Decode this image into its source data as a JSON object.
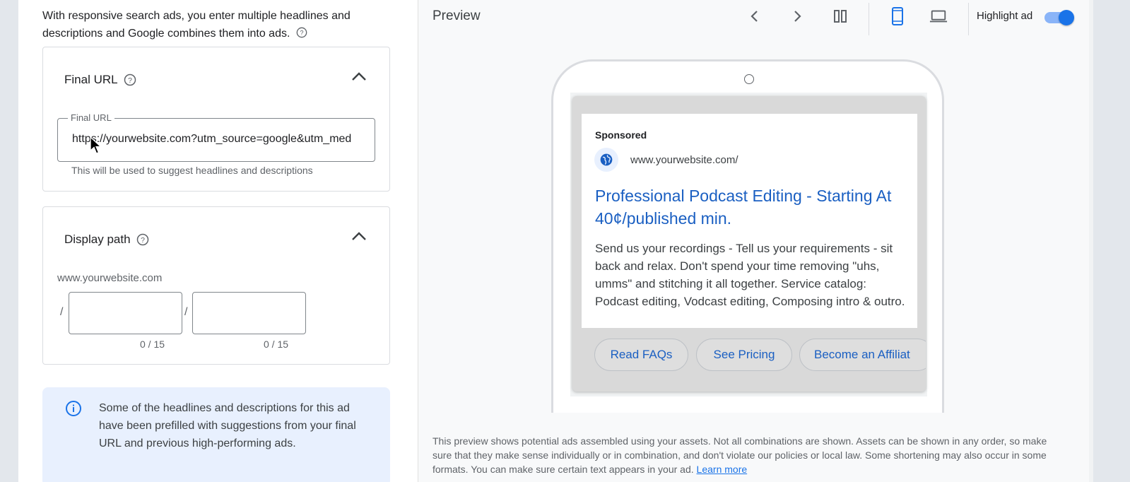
{
  "intro": {
    "text": "With responsive search ads, you enter multiple headlines and descriptions and Google combines them into ads."
  },
  "final_url_card": {
    "title": "Final URL",
    "field_label": "Final URL",
    "field_value": "https://yourwebsite.com?utm_source=google&utm_med",
    "hint": "This will be used to suggest headlines and descriptions"
  },
  "display_path_card": {
    "title": "Display path",
    "domain": "www.yourwebsite.com",
    "separator": "/",
    "path1_value": "",
    "path2_value": "",
    "path1_counter": "0 / 15",
    "path2_counter": "0 / 15"
  },
  "info_box": {
    "text": "Some of the headlines and descriptions for this ad have been prefilled with suggestions from your final URL and previous high-performing ads."
  },
  "preview": {
    "title": "Preview",
    "highlight_label": "Highlight ad",
    "highlight_on": true,
    "ad": {
      "sponsored": "Sponsored",
      "display_url": "www.yourwebsite.com/",
      "headline": "Professional Podcast Editing - Starting At 40¢/published min.",
      "description": "Send us your recordings - Tell us your requirements - sit back and relax. Don't spend your time removing \"uhs, umms\" and stitching it all together. Service catalog: Podcast editing, Vodcast editing, Composing intro & outro.",
      "sitelinks": [
        "Read FAQs",
        "See Pricing",
        "Become an Affiliat"
      ]
    },
    "disclaimer": "This preview shows potential ads assembled using your assets. Not all combinations are shown. Assets can be shown in any order, so make sure that they make sense individually or in combination, and don't violate our policies or local law. Some shortening may also occur in some formats. You can make sure certain text appears in your ad.",
    "learn_more": "Learn more"
  },
  "colors": {
    "accent": "#1a73e8",
    "ad_link": "#1a5fc2",
    "info_bg": "#e8f0fe"
  }
}
